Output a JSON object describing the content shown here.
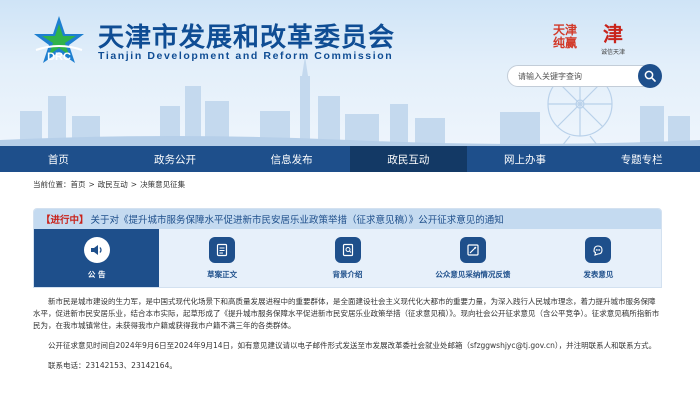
{
  "header": {
    "logo_text": "DRC",
    "title": "天津市发展和改革委员会",
    "subtitle": "Tianjin Development and Reform Commission",
    "badge_1": "天津\n纯赢",
    "badge_2": "津",
    "badge_2_small": "诚信天津"
  },
  "search": {
    "placeholder": "请输入关键字查询",
    "button_icon": "search-icon"
  },
  "nav": {
    "items": [
      {
        "label": "首页"
      },
      {
        "label": "政务公开"
      },
      {
        "label": "信息发布"
      },
      {
        "label": "政民互动"
      },
      {
        "label": "网上办事"
      },
      {
        "label": "专题专栏"
      }
    ],
    "active_index": 3
  },
  "breadcrumb": {
    "prefix": "当前位置：",
    "items": [
      "首页",
      "政民互动",
      "决策意见征集"
    ]
  },
  "notice": {
    "status": "【进行中】",
    "title": "关于对《提升城市服务保障水平促进新市民安居乐业政策举措（征求意见稿）》公开征求意见的通知",
    "tabs": [
      {
        "label": "公 告",
        "icon": "speaker-icon"
      },
      {
        "label": "草案正文",
        "icon": "document-icon"
      },
      {
        "label": "背景介绍",
        "icon": "info-icon"
      },
      {
        "label": "公众意见采纳情况反馈",
        "icon": "feedback-icon"
      },
      {
        "label": "发表意见",
        "icon": "pen-icon"
      }
    ],
    "active_tab": 0
  },
  "content": {
    "paragraphs": [
      "新市民是城市建设的生力军，是中国式现代化场景下和高质量发展进程中的重要群体，是全面建设社会主义现代化大都市的重要力量，为深入践行人民城市理念，着力提升城市服务保障水平，促进新市民安居乐业，结合本市实际，起草形成了《提升城市服务保障水平促进新市民安居乐业政策举措（征求意见稿）》。现向社会公开征求意见（含公平竞争）。征求意见稿所指新市民为，在我市城镇常住，未获得我市户籍或获得我市户籍不满三年的各类群体。",
      "公开征求意见时间自2024年9月6日至2024年9月14日，如有意见建议请以电子邮件形式发送至市发展改革委社会就业处邮箱（sfzggwshjyc@tj.gov.cn），并注明联系人和联系方式。",
      "联系电话：23142153、23142164。"
    ]
  },
  "colors": {
    "primary": "#1e4f8b",
    "nav_active": "#133965",
    "status_red": "#c9221a",
    "panel_bg": "#e7f0fa"
  }
}
